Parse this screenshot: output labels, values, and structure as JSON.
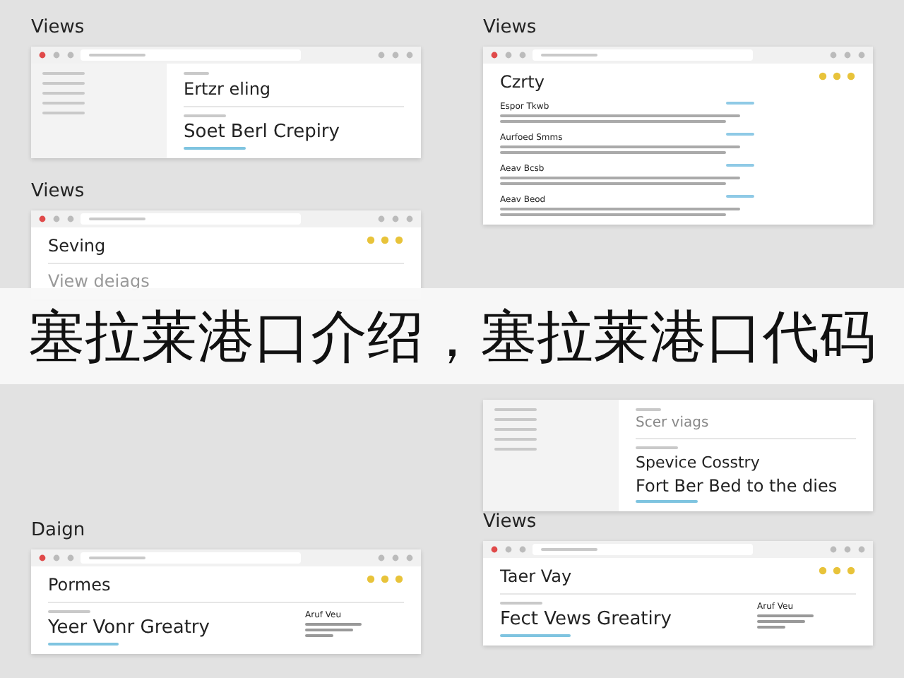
{
  "columns": [
    {
      "panels": [
        {
          "kind": "sidebar",
          "heading": "Views",
          "title": "Ertzr eling",
          "headline": "Soet Berl Crepiry"
        },
        {
          "kind": "reader",
          "heading": "Views",
          "title": "Seving",
          "headline": "View deiags"
        },
        {
          "kind": "hero",
          "heading": "Daign",
          "title": "Pormes",
          "headline": "Yeer Vonr Greatry",
          "aside": "Aruf Veu"
        }
      ]
    },
    {
      "panels": [
        {
          "kind": "list",
          "heading": "Views",
          "title": "Czrty",
          "entries": [
            "Espor Tkwb",
            "Aurfoed Smms",
            "Aeav Bcsb",
            "Aeav Beod"
          ]
        },
        {
          "kind": "sidebar",
          "title": "Scer viags",
          "headline": "Spevice Cosstry",
          "second": "Fort Ber Bed to the dies"
        },
        {
          "kind": "hero",
          "heading": "Views",
          "title": "Taer Vay",
          "headline": "Fect Vews Greatiry",
          "aside": "Aruf Veu"
        }
      ]
    }
  ],
  "banner": {
    "text": "塞拉莱港口介绍，塞拉莱港口代码"
  }
}
